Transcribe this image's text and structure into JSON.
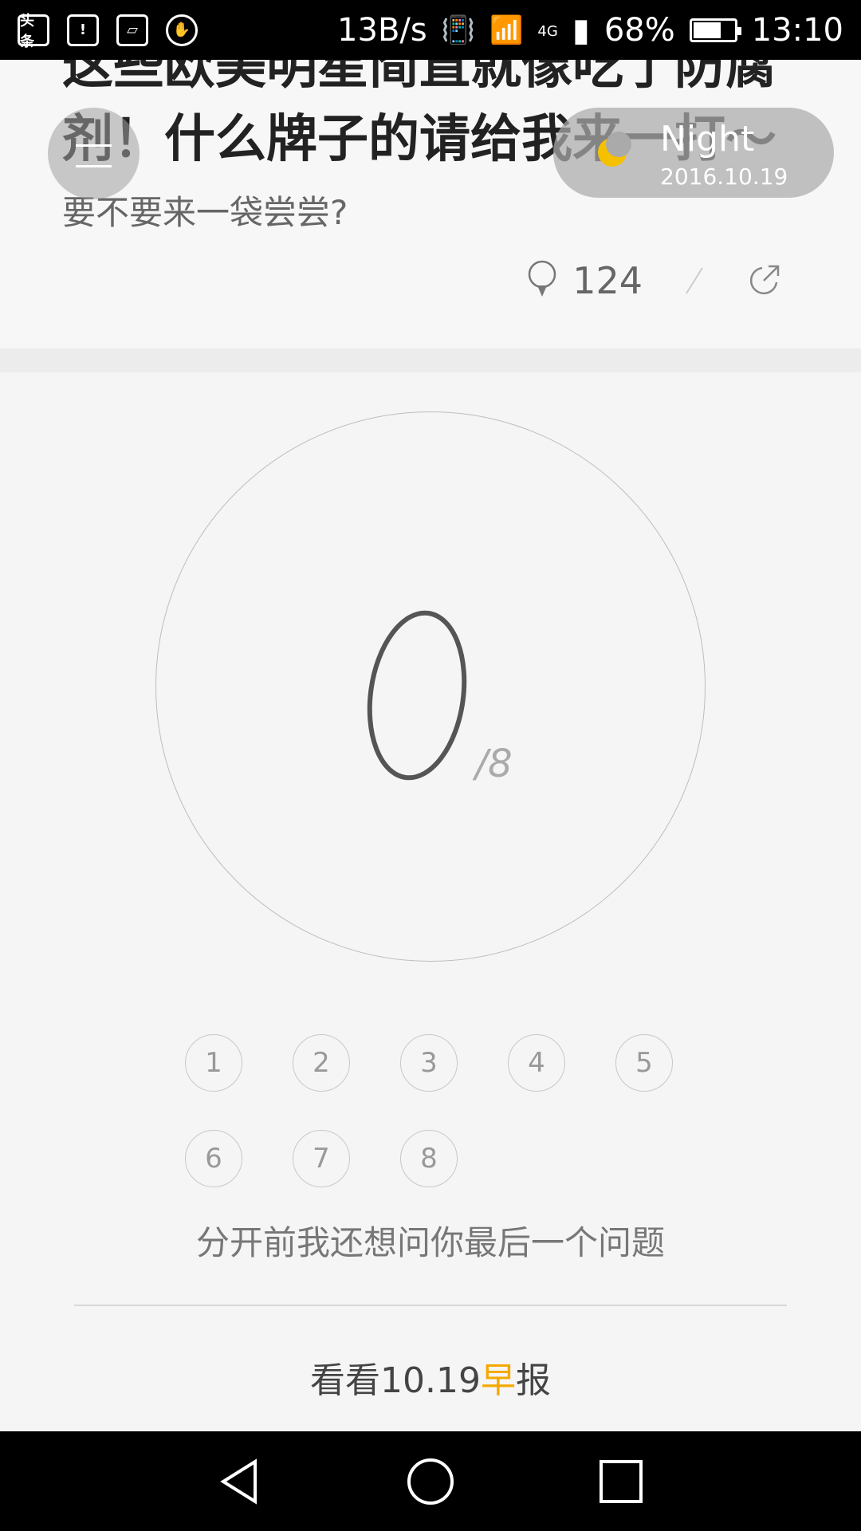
{
  "status_bar": {
    "app_icon_text": "头条",
    "net_speed": "13B/s",
    "network_type": "4G",
    "battery_percent": "68%",
    "battery_level": 0.68,
    "time": "13:10"
  },
  "article": {
    "title_line1": "这些欧美明星简直就像吃了防腐",
    "title_line2": "剂！什么牌子的请给我来一打～",
    "subtitle": "要不要来一袋尝尝?",
    "like_count": "124"
  },
  "night_toggle": {
    "label": "Night",
    "date": "2016.10.19"
  },
  "quiz": {
    "current": "0",
    "total": "/8",
    "numbers": [
      "1",
      "2",
      "3",
      "4",
      "5",
      "6",
      "7",
      "8"
    ],
    "question": "分开前我还想问你最后一个问题"
  },
  "footer": {
    "prefix": "看看10.19",
    "highlight": "早",
    "suffix": "报",
    "highlight_color": "#f5a800"
  }
}
